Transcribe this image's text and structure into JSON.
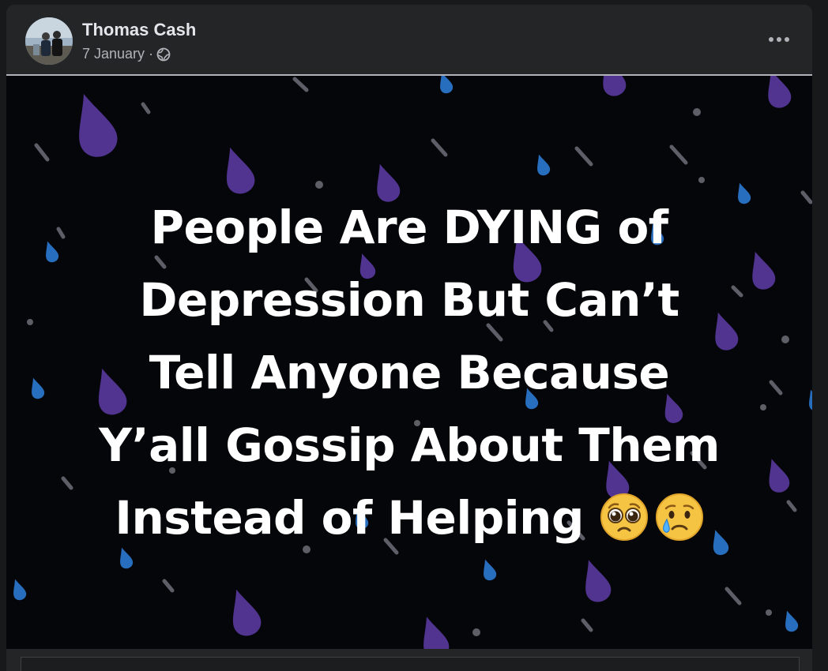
{
  "post": {
    "author": "Thomas Cash",
    "date": "7 January",
    "separator": "·",
    "privacy_icon": "globe-icon",
    "more_icon": "more-options-icon"
  },
  "image": {
    "lines": [
      "People Are DYING of",
      "Depression But Can’t",
      "Tell Anyone Because",
      "Y’all Gossip About Them",
      "Instead of Helping"
    ],
    "emojis": [
      "pleading-face-icon",
      "crying-face-icon"
    ],
    "colors": {
      "background": "#05060a",
      "text": "#ffffff",
      "drop_purple": "#5b3aa0",
      "drop_blue": "#2b74c9",
      "drop_grey": "#6e6f78"
    }
  }
}
